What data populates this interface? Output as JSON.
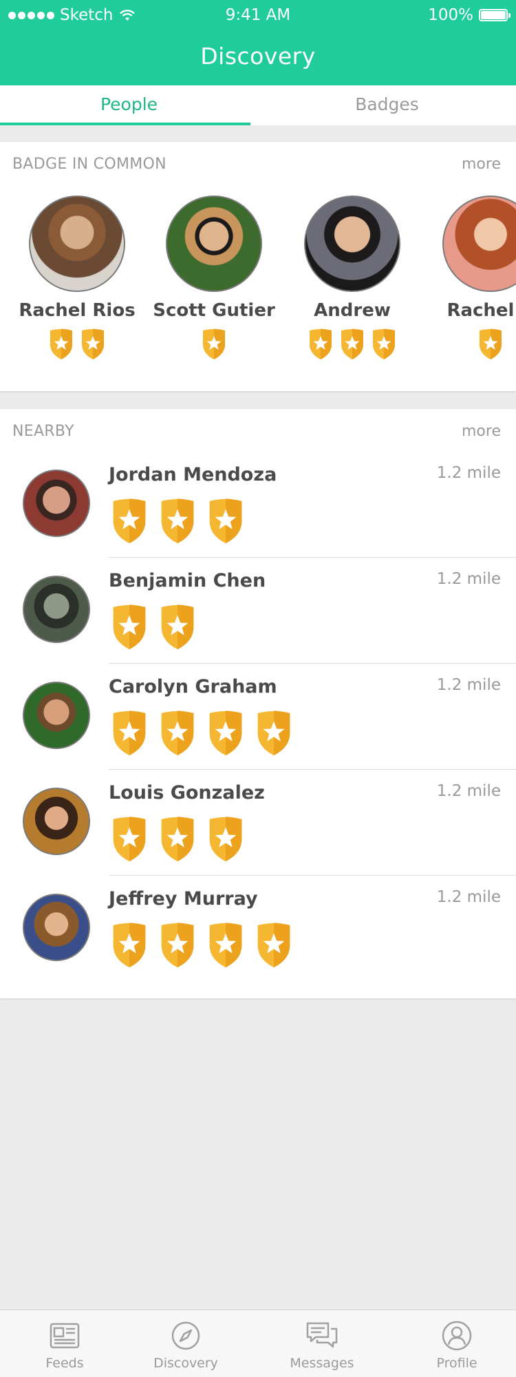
{
  "status_bar": {
    "carrier": "Sketch",
    "time": "9:41 AM",
    "battery": "100%"
  },
  "header": {
    "title": "Discovery"
  },
  "tabs": [
    {
      "label": "People",
      "active": true
    },
    {
      "label": "Badges",
      "active": false
    }
  ],
  "badge_in_common": {
    "title": "BADGE IN COMMON",
    "more": "more",
    "people": [
      {
        "name": "Rachel Rios",
        "badges": 2
      },
      {
        "name": "Scott Gutier",
        "badges": 1
      },
      {
        "name": "Andrew",
        "badges": 3
      },
      {
        "name": "Rachel R",
        "badges": 1
      }
    ]
  },
  "nearby": {
    "title": "NEARBY",
    "more": "more",
    "people": [
      {
        "name": "Jordan Mendoza",
        "distance": "1.2 mile",
        "badges": 3
      },
      {
        "name": "Benjamin Chen",
        "distance": "1.2 mile",
        "badges": 2
      },
      {
        "name": "Carolyn Graham",
        "distance": "1.2 mile",
        "badges": 4
      },
      {
        "name": "Louis Gonzalez",
        "distance": "1.2 mile",
        "badges": 3
      },
      {
        "name": "Jeffrey Murray",
        "distance": "1.2 mile",
        "badges": 4
      }
    ]
  },
  "tabbar": [
    {
      "label": "Feeds",
      "icon": "newspaper-icon"
    },
    {
      "label": "Discovery",
      "icon": "compass-icon"
    },
    {
      "label": "Messages",
      "icon": "chat-icon"
    },
    {
      "label": "Profile",
      "icon": "user-icon"
    }
  ],
  "colors": {
    "accent": "#1fcc9a",
    "active_tab_text": "#1fb787",
    "badge": "#f5b731"
  }
}
